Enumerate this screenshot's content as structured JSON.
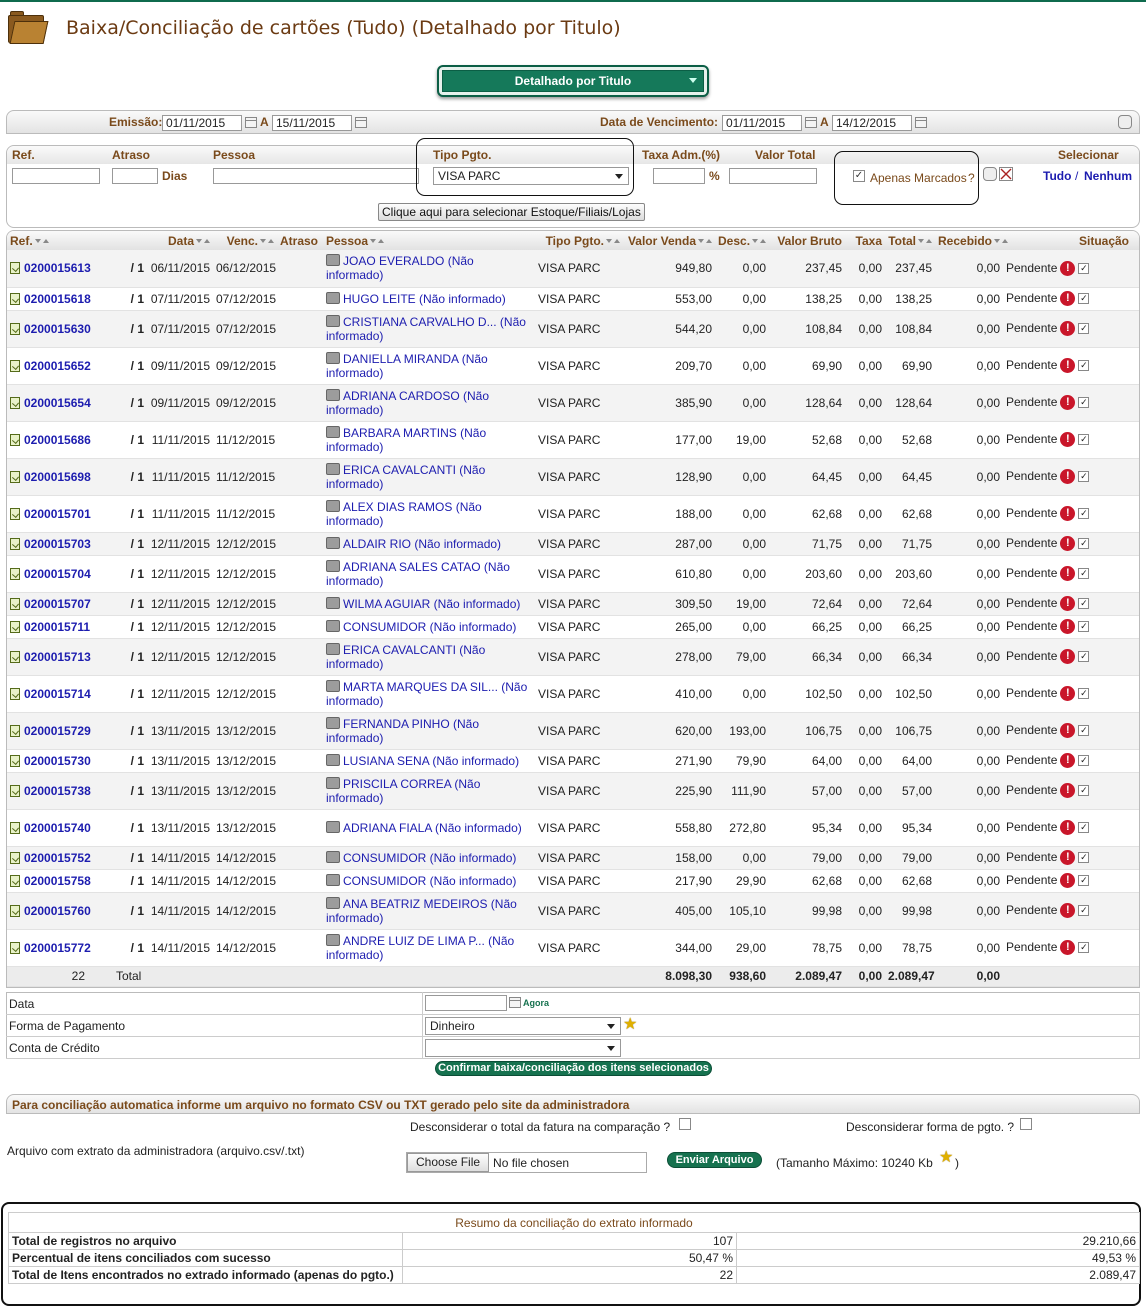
{
  "page": {
    "title": "Baixa/Conciliação de cartões (Tudo) (Detalhado por Titulo)"
  },
  "mode": {
    "selected": "Detalhado por Titulo"
  },
  "filters": {
    "emissao_label": "Emissão:",
    "emissao_from": "01/11/2015",
    "a_label": "A",
    "emissao_to": "15/11/2015",
    "vencimento_label": "Data de Vencimento:",
    "venc_from": "01/11/2015",
    "venc_to": "14/12/2015",
    "ref_label": "Ref.",
    "atraso_label": "Atraso",
    "dias_label": "Dias",
    "pessoa_label": "Pessoa",
    "tipo_label": "Tipo Pgto.",
    "tipo_value": "VISA PARC",
    "taxa_label": "Taxa Adm.(%)",
    "percent": "%",
    "valor_total_label": "Valor Total",
    "apenas_label": "Apenas Marcados",
    "question": "?",
    "selecionar_label": "Selecionar",
    "tudo": "Tudo",
    "slash": "/",
    "nenhum": "Nenhum",
    "estoque_button": "Clique aqui para selecionar Estoque/Filiais/Lojas"
  },
  "table": {
    "headers": {
      "ref": "Ref.",
      "data": "Data",
      "venc": "Venc.",
      "atraso": "Atraso",
      "pessoa": "Pessoa",
      "tipo": "Tipo Pgto.",
      "valor_venda": "Valor Venda",
      "desc": "Desc.",
      "valor_bruto": "Valor Bruto",
      "taxa": "Taxa",
      "total": "Total",
      "recebido": "Recebido",
      "situacao": "Situação"
    },
    "rows": [
      {
        "ref": "0200015613",
        "parc": "/ 1",
        "data": "06/11/2015",
        "venc": "06/12/2015",
        "pessoa": "JOAO EVERALDO (Não informado)",
        "tipo": "VISA PARC",
        "venda": "949,80",
        "desc": "0,00",
        "bruto": "237,45",
        "taxa": "0,00",
        "total": "237,45",
        "recebido": "0,00",
        "situacao": "Pendente"
      },
      {
        "ref": "0200015618",
        "parc": "/ 1",
        "data": "07/11/2015",
        "venc": "07/12/2015",
        "pessoa": "HUGO LEITE (Não informado)",
        "tipo": "VISA PARC",
        "venda": "553,00",
        "desc": "0,00",
        "bruto": "138,25",
        "taxa": "0,00",
        "total": "138,25",
        "recebido": "0,00",
        "situacao": "Pendente"
      },
      {
        "ref": "0200015630",
        "parc": "/ 1",
        "data": "07/11/2015",
        "venc": "07/12/2015",
        "pessoa": "CRISTIANA CARVALHO D... (Não informado)",
        "tipo": "VISA PARC",
        "venda": "544,20",
        "desc": "0,00",
        "bruto": "108,84",
        "taxa": "0,00",
        "total": "108,84",
        "recebido": "0,00",
        "situacao": "Pendente"
      },
      {
        "ref": "0200015652",
        "parc": "/ 1",
        "data": "09/11/2015",
        "venc": "09/12/2015",
        "pessoa": "DANIELLA MIRANDA (Não informado)",
        "tipo": "VISA PARC",
        "venda": "209,70",
        "desc": "0,00",
        "bruto": "69,90",
        "taxa": "0,00",
        "total": "69,90",
        "recebido": "0,00",
        "situacao": "Pendente"
      },
      {
        "ref": "0200015654",
        "parc": "/ 1",
        "data": "09/11/2015",
        "venc": "09/12/2015",
        "pessoa": "ADRIANA CARDOSO (Não informado)",
        "tipo": "VISA PARC",
        "venda": "385,90",
        "desc": "0,00",
        "bruto": "128,64",
        "taxa": "0,00",
        "total": "128,64",
        "recebido": "0,00",
        "situacao": "Pendente"
      },
      {
        "ref": "0200015686",
        "parc": "/ 1",
        "data": "11/11/2015",
        "venc": "11/12/2015",
        "pessoa": "BARBARA MARTINS (Não informado)",
        "tipo": "VISA PARC",
        "venda": "177,00",
        "desc": "19,00",
        "bruto": "52,68",
        "taxa": "0,00",
        "total": "52,68",
        "recebido": "0,00",
        "situacao": "Pendente"
      },
      {
        "ref": "0200015698",
        "parc": "/ 1",
        "data": "11/11/2015",
        "venc": "11/12/2015",
        "pessoa": "ERICA CAVALCANTI (Não informado)",
        "tipo": "VISA PARC",
        "venda": "128,90",
        "desc": "0,00",
        "bruto": "64,45",
        "taxa": "0,00",
        "total": "64,45",
        "recebido": "0,00",
        "situacao": "Pendente"
      },
      {
        "ref": "0200015701",
        "parc": "/ 1",
        "data": "11/11/2015",
        "venc": "11/12/2015",
        "pessoa": "ALEX DIAS RAMOS (Não informado)",
        "tipo": "VISA PARC",
        "venda": "188,00",
        "desc": "0,00",
        "bruto": "62,68",
        "taxa": "0,00",
        "total": "62,68",
        "recebido": "0,00",
        "situacao": "Pendente"
      },
      {
        "ref": "0200015703",
        "parc": "/ 1",
        "data": "12/11/2015",
        "venc": "12/12/2015",
        "pessoa": "ALDAIR RIO (Não informado)",
        "tipo": "VISA PARC",
        "venda": "287,00",
        "desc": "0,00",
        "bruto": "71,75",
        "taxa": "0,00",
        "total": "71,75",
        "recebido": "0,00",
        "situacao": "Pendente"
      },
      {
        "ref": "0200015704",
        "parc": "/ 1",
        "data": "12/11/2015",
        "venc": "12/12/2015",
        "pessoa": "ADRIANA SALES CATAO (Não informado)",
        "tipo": "VISA PARC",
        "venda": "610,80",
        "desc": "0,00",
        "bruto": "203,60",
        "taxa": "0,00",
        "total": "203,60",
        "recebido": "0,00",
        "situacao": "Pendente"
      },
      {
        "ref": "0200015707",
        "parc": "/ 1",
        "data": "12/11/2015",
        "venc": "12/12/2015",
        "pessoa": "WILMA AGUIAR (Não informado)",
        "tipo": "VISA PARC",
        "venda": "309,50",
        "desc": "19,00",
        "bruto": "72,64",
        "taxa": "0,00",
        "total": "72,64",
        "recebido": "0,00",
        "situacao": "Pendente"
      },
      {
        "ref": "0200015711",
        "parc": "/ 1",
        "data": "12/11/2015",
        "venc": "12/12/2015",
        "pessoa": "CONSUMIDOR (Não informado)",
        "tipo": "VISA PARC",
        "venda": "265,00",
        "desc": "0,00",
        "bruto": "66,25",
        "taxa": "0,00",
        "total": "66,25",
        "recebido": "0,00",
        "situacao": "Pendente"
      },
      {
        "ref": "0200015713",
        "parc": "/ 1",
        "data": "12/11/2015",
        "venc": "12/12/2015",
        "pessoa": "ERICA CAVALCANTI (Não informado)",
        "tipo": "VISA PARC",
        "venda": "278,00",
        "desc": "79,00",
        "bruto": "66,34",
        "taxa": "0,00",
        "total": "66,34",
        "recebido": "0,00",
        "situacao": "Pendente"
      },
      {
        "ref": "0200015714",
        "parc": "/ 1",
        "data": "12/11/2015",
        "venc": "12/12/2015",
        "pessoa": "MARTA MARQUES DA SIL... (Não informado)",
        "tipo": "VISA PARC",
        "venda": "410,00",
        "desc": "0,00",
        "bruto": "102,50",
        "taxa": "0,00",
        "total": "102,50",
        "recebido": "0,00",
        "situacao": "Pendente"
      },
      {
        "ref": "0200015729",
        "parc": "/ 1",
        "data": "13/11/2015",
        "venc": "13/12/2015",
        "pessoa": "FERNANDA PINHO (Não informado)",
        "tipo": "VISA PARC",
        "venda": "620,00",
        "desc": "193,00",
        "bruto": "106,75",
        "taxa": "0,00",
        "total": "106,75",
        "recebido": "0,00",
        "situacao": "Pendente"
      },
      {
        "ref": "0200015730",
        "parc": "/ 1",
        "data": "13/11/2015",
        "venc": "13/12/2015",
        "pessoa": "LUSIANA SENA (Não informado)",
        "tipo": "VISA PARC",
        "venda": "271,90",
        "desc": "79,90",
        "bruto": "64,00",
        "taxa": "0,00",
        "total": "64,00",
        "recebido": "0,00",
        "situacao": "Pendente"
      },
      {
        "ref": "0200015738",
        "parc": "/ 1",
        "data": "13/11/2015",
        "venc": "13/12/2015",
        "pessoa": "PRISCILA CORREA (Não informado)",
        "tipo": "VISA PARC",
        "venda": "225,90",
        "desc": "111,90",
        "bruto": "57,00",
        "taxa": "0,00",
        "total": "57,00",
        "recebido": "0,00",
        "situacao": "Pendente"
      },
      {
        "ref": "0200015740",
        "parc": "/ 1",
        "data": "13/11/2015",
        "venc": "13/12/2015",
        "pessoa": "ADRIANA FIALA (Não informado)",
        "tipo": "VISA PARC",
        "venda": "558,80",
        "desc": "272,80",
        "bruto": "95,34",
        "taxa": "0,00",
        "total": "95,34",
        "recebido": "0,00",
        "situacao": "Pendente"
      },
      {
        "ref": "0200015752",
        "parc": "/ 1",
        "data": "14/11/2015",
        "venc": "14/12/2015",
        "pessoa": "CONSUMIDOR (Não informado)",
        "tipo": "VISA PARC",
        "venda": "158,00",
        "desc": "0,00",
        "bruto": "79,00",
        "taxa": "0,00",
        "total": "79,00",
        "recebido": "0,00",
        "situacao": "Pendente"
      },
      {
        "ref": "0200015758",
        "parc": "/ 1",
        "data": "14/11/2015",
        "venc": "14/12/2015",
        "pessoa": "CONSUMIDOR (Não informado)",
        "tipo": "VISA PARC",
        "venda": "217,90",
        "desc": "29,90",
        "bruto": "62,68",
        "taxa": "0,00",
        "total": "62,68",
        "recebido": "0,00",
        "situacao": "Pendente"
      },
      {
        "ref": "0200015760",
        "parc": "/ 1",
        "data": "14/11/2015",
        "venc": "14/12/2015",
        "pessoa": "ANA BEATRIZ MEDEIROS (Não informado)",
        "tipo": "VISA PARC",
        "venda": "405,00",
        "desc": "105,10",
        "bruto": "99,98",
        "taxa": "0,00",
        "total": "99,98",
        "recebido": "0,00",
        "situacao": "Pendente"
      },
      {
        "ref": "0200015772",
        "parc": "/ 1",
        "data": "14/11/2015",
        "venc": "14/12/2015",
        "pessoa": "ANDRE LUIZ DE LIMA P... (Não informado)",
        "tipo": "VISA PARC",
        "venda": "344,00",
        "desc": "29,00",
        "bruto": "78,75",
        "taxa": "0,00",
        "total": "78,75",
        "recebido": "0,00",
        "situacao": "Pendente"
      }
    ],
    "totals": {
      "count": "22",
      "label": "Total",
      "venda": "8.098,30",
      "desc": "938,60",
      "bruto": "2.089,47",
      "taxa": "0,00",
      "total": "2.089,47",
      "recebido": "0,00"
    }
  },
  "baixa": {
    "data_label": "Data",
    "agora": "Agora",
    "forma_label": "Forma de Pagamento",
    "forma_value": "Dinheiro",
    "conta_label": "Conta de Crédito",
    "conta_value": "",
    "confirm_button": "Confirmar baixa/conciliação dos itens selecionados"
  },
  "csv": {
    "header": "Para conciliação automatica informe um arquivo no formato CSV ou TXT gerado pelo site da administradora",
    "ignore_total": "Desconsiderar o total da fatura na comparação ?",
    "ignore_forma": "Desconsiderar forma de pgto. ?",
    "arquivo_label": "Arquivo com extrato da administradora (arquivo.csv/.txt)",
    "choose_file": "Choose File",
    "no_file": "No file chosen",
    "send_button": "Enviar Arquivo",
    "max_size": "(Tamanho Máximo: 10240 Kb",
    "max_close": ")"
  },
  "resumo": {
    "title": "Resumo da conciliação do extrato informado",
    "rows": [
      {
        "label": "Total de registros no arquivo",
        "a": "107",
        "b": "29.210,66"
      },
      {
        "label": "Percentual de itens conciliados com sucesso",
        "a": "50,47 %",
        "b": "49,53 %"
      },
      {
        "label": "Total de Itens encontrados no extrado informado (apenas do pgto.)",
        "a": "22",
        "b": "2.089,47"
      }
    ]
  }
}
